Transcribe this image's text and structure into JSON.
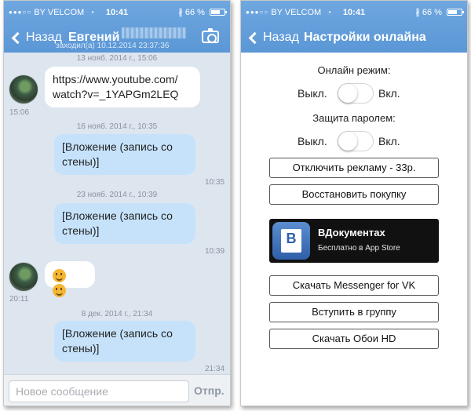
{
  "status": {
    "carrier": "BY VELCOM",
    "time": "10:41",
    "battery": "66 %",
    "signal_dots": "●●●○○"
  },
  "chat": {
    "back_label": "Назад",
    "contact_name": "Евгений",
    "last_seen": "заходил(а) 10.12.2014 23:37:36",
    "messages": [
      {
        "date": "13 нояб. 2014 г., 15:06",
        "text": "https://www.youtube.com/watch?v=_1YAPGm2LEQ",
        "line1": "https://www.youtube.com/",
        "line2": "watch?v=_1YAPGm2LEQ",
        "time": "15:06",
        "direction": "incoming"
      },
      {
        "date": "16 нояб. 2014 г., 10:35",
        "line1": "[Вложение (запись со",
        "line2": "стены)]",
        "time": "10:35",
        "direction": "outgoing"
      },
      {
        "date": "23 нояб. 2014 г., 10:39",
        "line1": "[Вложение (запись со",
        "line2": "стены)]",
        "time": "10:39",
        "direction": "outgoing"
      },
      {
        "date": "",
        "emoji": [
          "grin-emoji",
          "grin-emoji"
        ],
        "time": "20:11",
        "direction": "incoming"
      },
      {
        "date": "8 дек. 2014 г., 21:34",
        "line1": "[Вложение (запись со",
        "line2": "стены)]",
        "time": "21:34",
        "direction": "outgoing"
      }
    ],
    "composer": {
      "placeholder": "Новое сообщение",
      "send_label": "Отпр."
    }
  },
  "settings": {
    "back_label": "Назад",
    "title": "Настройки онлайна",
    "online_mode": {
      "label": "Онлайн режим:",
      "off": "Выкл.",
      "on": "Вкл.",
      "enabled": false
    },
    "password_protection": {
      "label": "Защита паролем:",
      "off": "Выкл.",
      "on": "Вкл.",
      "enabled": false
    },
    "buttons": {
      "disable_ads": "Отключить рекламу - 33р.",
      "restore_purchase": "Восстановить покупку",
      "download_messenger": "Скачать Messenger for VK",
      "join_group": "Вступить в группу",
      "download_wallpapers": "Скачать Обои HD"
    },
    "banner": {
      "title": "ВДокументах",
      "subtitle": "Бесплатно в App Store"
    }
  },
  "colors": {
    "nav_bar": "#5b97d6",
    "chat_background": "#dde5ef",
    "outgoing_bubble": "#c6e2fb",
    "incoming_bubble": "#ffffff",
    "banner_background": "#111111"
  }
}
